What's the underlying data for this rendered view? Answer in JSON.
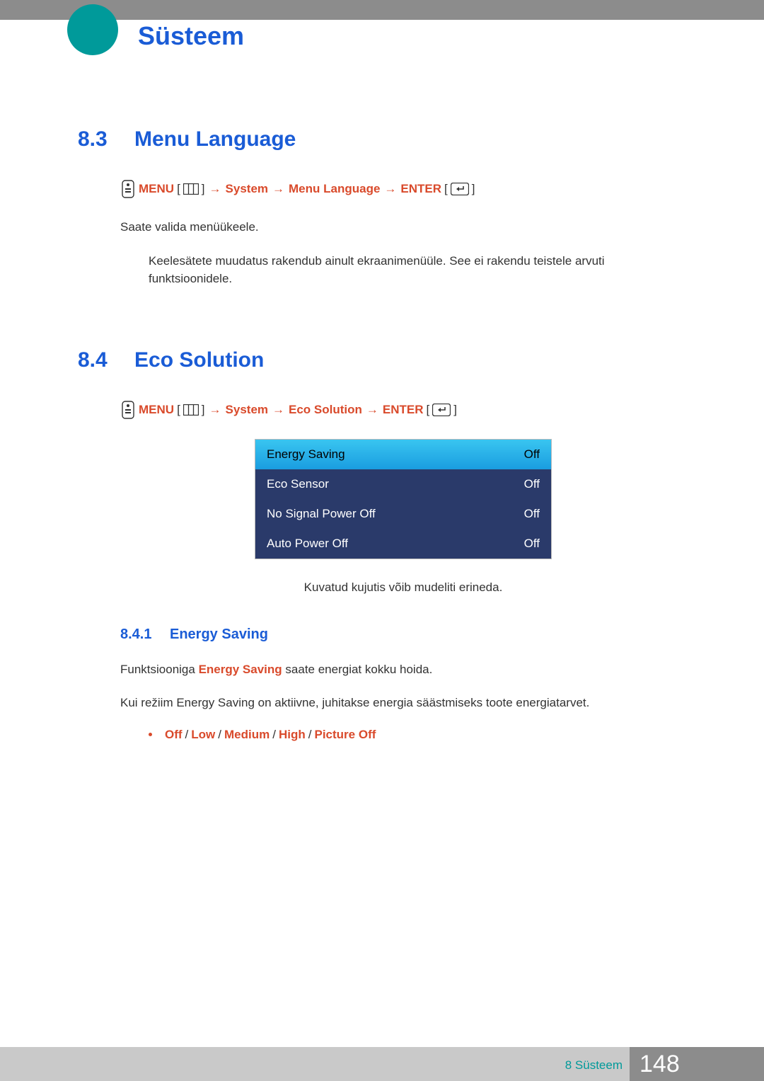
{
  "chapter_title": "Süsteem",
  "sections": {
    "s83": {
      "num": "8.3",
      "title": "Menu Language",
      "path_menu": "MENU",
      "path_system": "System",
      "path_item": "Menu Language",
      "path_enter": "ENTER",
      "para1": "Saate valida menüükeele.",
      "note": "Keelesätete muudatus rakendub ainult ekraanimenüüle. See ei rakendu teistele arvuti funktsioonidele."
    },
    "s84": {
      "num": "8.4",
      "title": "Eco Solution",
      "path_menu": "MENU",
      "path_system": "System",
      "path_item": "Eco Solution",
      "path_enter": "ENTER",
      "osd": [
        {
          "label": "Energy Saving",
          "value": "Off"
        },
        {
          "label": "Eco Sensor",
          "value": "Off"
        },
        {
          "label": "No Signal Power Off",
          "value": "Off"
        },
        {
          "label": "Auto Power Off",
          "value": "Off"
        }
      ],
      "osd_caption": "Kuvatud kujutis võib mudeliti erineda.",
      "sub841": {
        "num": "8.4.1",
        "title": "Energy Saving",
        "para1_pre": "Funktsiooniga ",
        "para1_hl": "Energy Saving",
        "para1_post": " saate energiat kokku hoida.",
        "para2": "Kui režiim Energy Saving on aktiivne, juhitakse energia säästmiseks toote energiatarvet.",
        "options": [
          "Off",
          "Low",
          "Medium",
          "High",
          "Picture Off"
        ]
      }
    }
  },
  "footer": {
    "chapter_label": "8 Süsteem",
    "page": "148"
  }
}
